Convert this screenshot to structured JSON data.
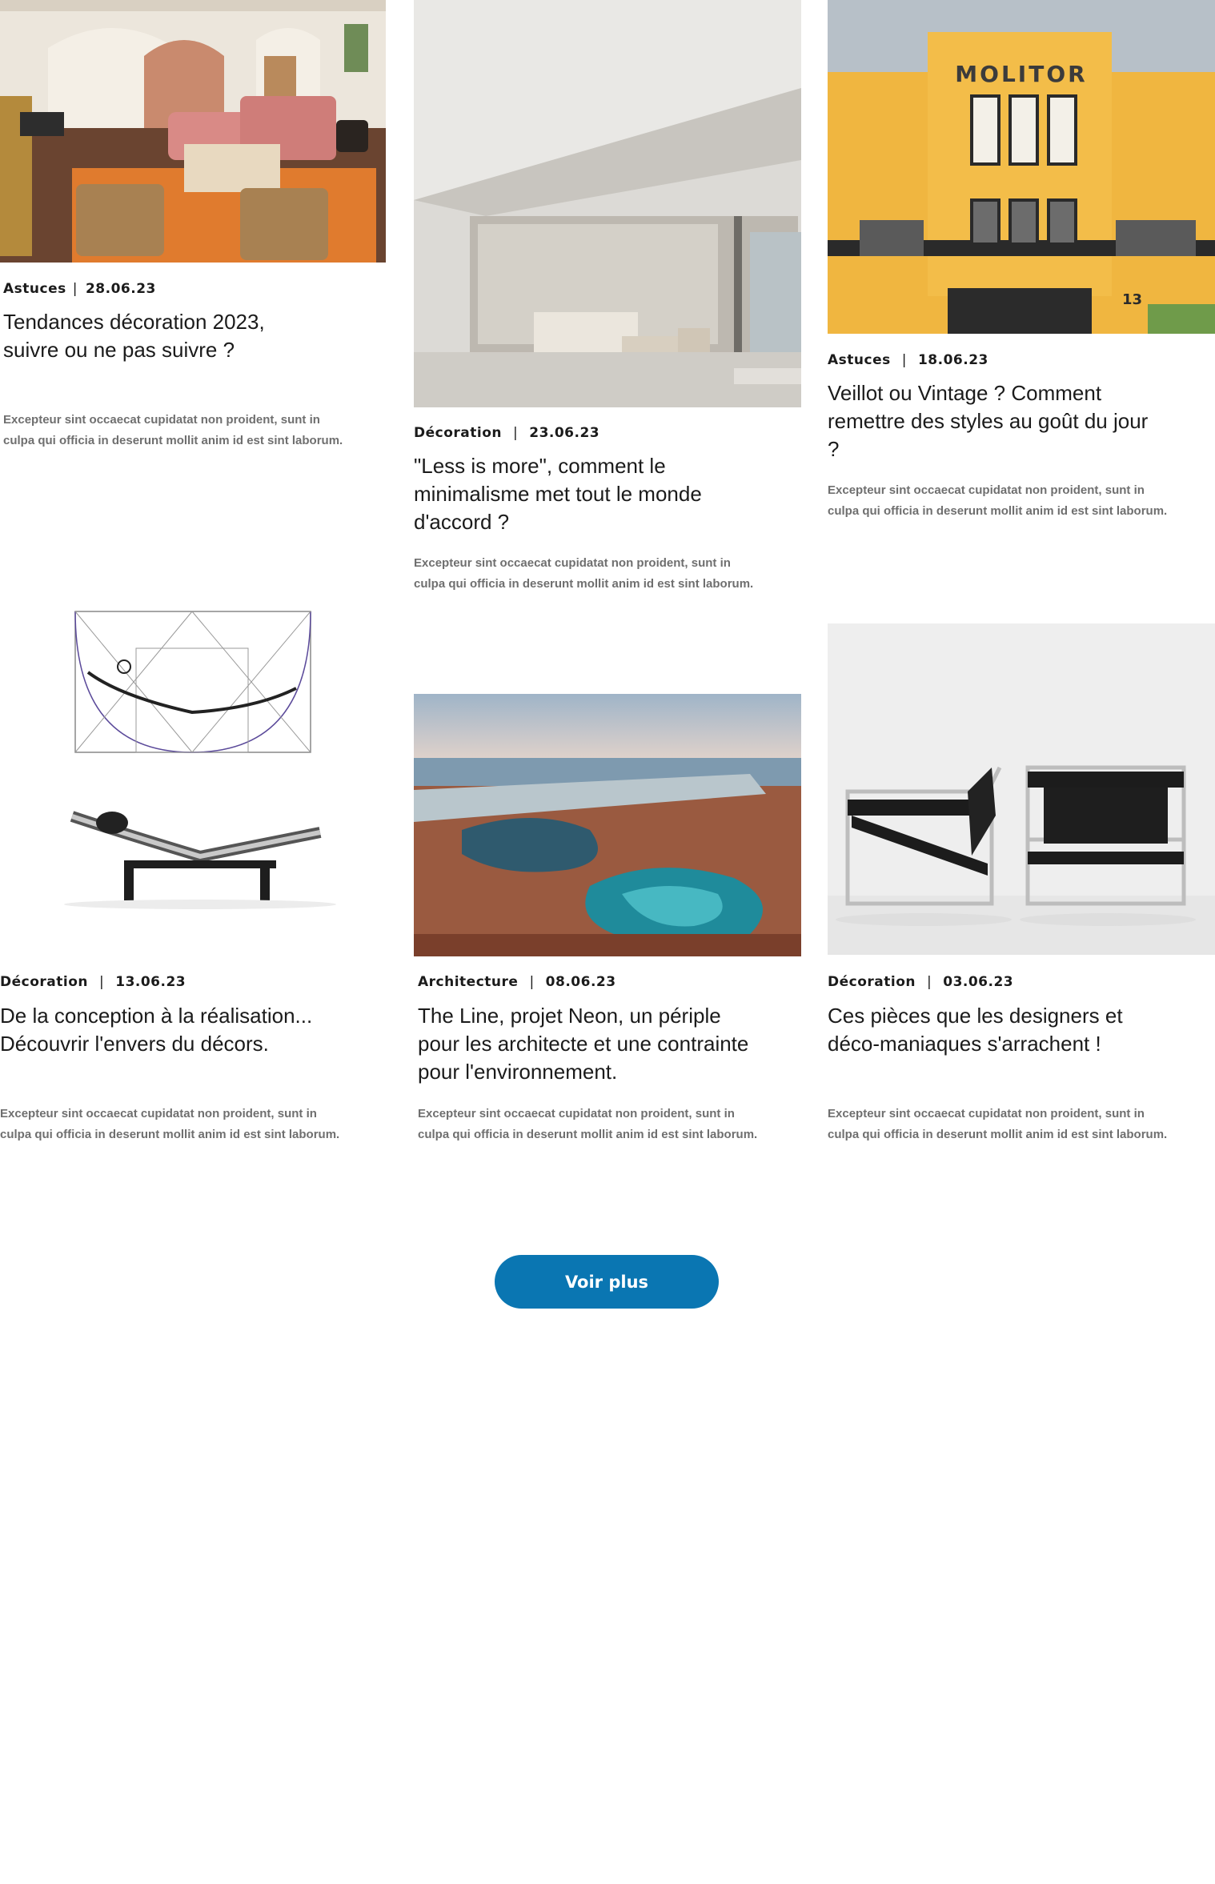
{
  "articles": [
    {
      "category": "Astuces",
      "date": "28.06.23",
      "title": "Tendances décoration 2023, suivre ou ne pas suivre ?",
      "excerpt": "Excepteur sint occaecat cupidatat non proident, sunt in culpa qui officia in deserunt mollit anim id est sint laborum."
    },
    {
      "category": "Décoration",
      "date": "23.06.23",
      "title": "\"Less is more\", comment le minimalisme met tout le monde d'accord ?",
      "excerpt": "Excepteur sint occaecat cupidatat non proident, sunt in culpa qui officia in deserunt mollit anim id est sint laborum."
    },
    {
      "category": "Astuces",
      "date": "18.06.23",
      "title": "Veillot ou Vintage ? Comment remettre des styles au goût du jour ?",
      "excerpt": "Excepteur sint occaecat cupidatat non proident, sunt in culpa qui officia in deserunt mollit anim id est sint laborum.",
      "image_sign": "MOLITOR",
      "image_number": "13"
    },
    {
      "category": "Décoration",
      "date": "13.06.23",
      "title": "De la conception à la réalisation... Découvrir l'envers du décors.",
      "excerpt": "Excepteur sint occaecat cupidatat non proident, sunt in culpa qui officia in deserunt mollit anim id est sint laborum."
    },
    {
      "category": "Architecture",
      "date": "08.06.23",
      "title": "The Line, projet Neon, un périple pour les architecte et une contrainte pour l'environnement.",
      "excerpt": "Excepteur sint occaecat cupidatat non proident, sunt in culpa qui officia in deserunt mollit anim id est sint laborum."
    },
    {
      "category": "Décoration",
      "date": "03.06.23",
      "title": "Ces pièces que les designers et déco-maniaques s'arrachent !",
      "excerpt": "Excepteur sint occaecat cupidatat non proident, sunt in culpa qui officia in deserunt mollit anim id est sint laborum."
    }
  ],
  "load_more": {
    "label": "Voir plus"
  },
  "colors": {
    "accent": "#0a76b2",
    "text": "#1b1b1b",
    "muted": "#6f6f6f"
  }
}
